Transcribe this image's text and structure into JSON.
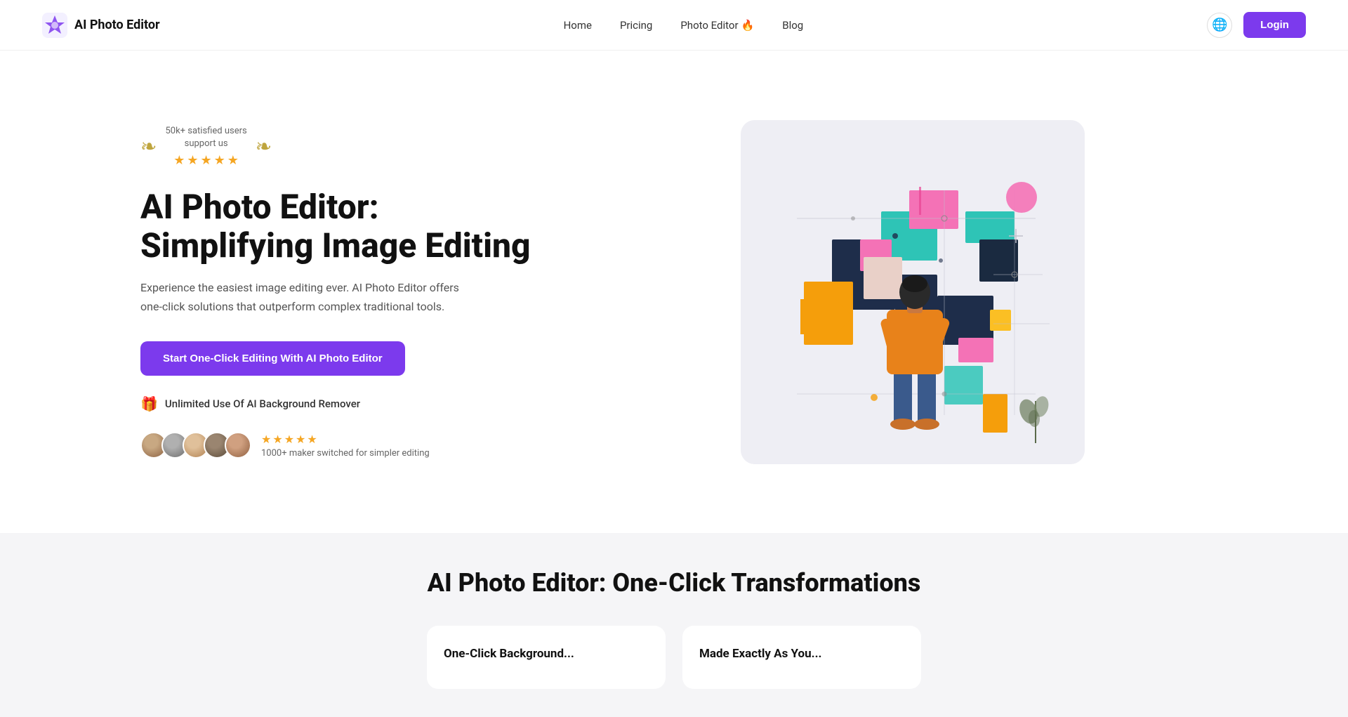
{
  "navbar": {
    "brand_icon_alt": "AI Photo Editor logo",
    "brand_name": "AI Photo Editor",
    "nav_links": [
      {
        "id": "home",
        "label": "Home"
      },
      {
        "id": "pricing",
        "label": "Pricing"
      },
      {
        "id": "photo-editor",
        "label": "Photo Editor",
        "has_fire": true
      },
      {
        "id": "blog",
        "label": "Blog"
      }
    ],
    "globe_icon": "🌐",
    "login_label": "Login"
  },
  "hero": {
    "badge": {
      "text_line1": "50k+ satisfied users",
      "text_line2": "support us",
      "stars": 5
    },
    "title": "AI Photo Editor: Simplifying Image Editing",
    "description": "Experience the easiest image editing ever. AI Photo Editor offers one-click solutions that outperform complex traditional tools.",
    "cta_label": "Start One-Click Editing With AI Photo Editor",
    "free_feature": "Unlimited Use Of AI Background Remover",
    "gift_icon": "🎁",
    "makers": {
      "stars": 5,
      "text": "1000+ maker switched for simpler editing"
    }
  },
  "bottom": {
    "title": "AI Photo Editor: One-Click Transformations",
    "cards": [
      {
        "id": "card1",
        "title": "One-Click Background..."
      },
      {
        "id": "card2",
        "title": "Made Exactly As You..."
      }
    ]
  },
  "colors": {
    "accent": "#7c3aed",
    "star_gold": "#f5a623",
    "text_dark": "#111111",
    "text_muted": "#666666"
  }
}
